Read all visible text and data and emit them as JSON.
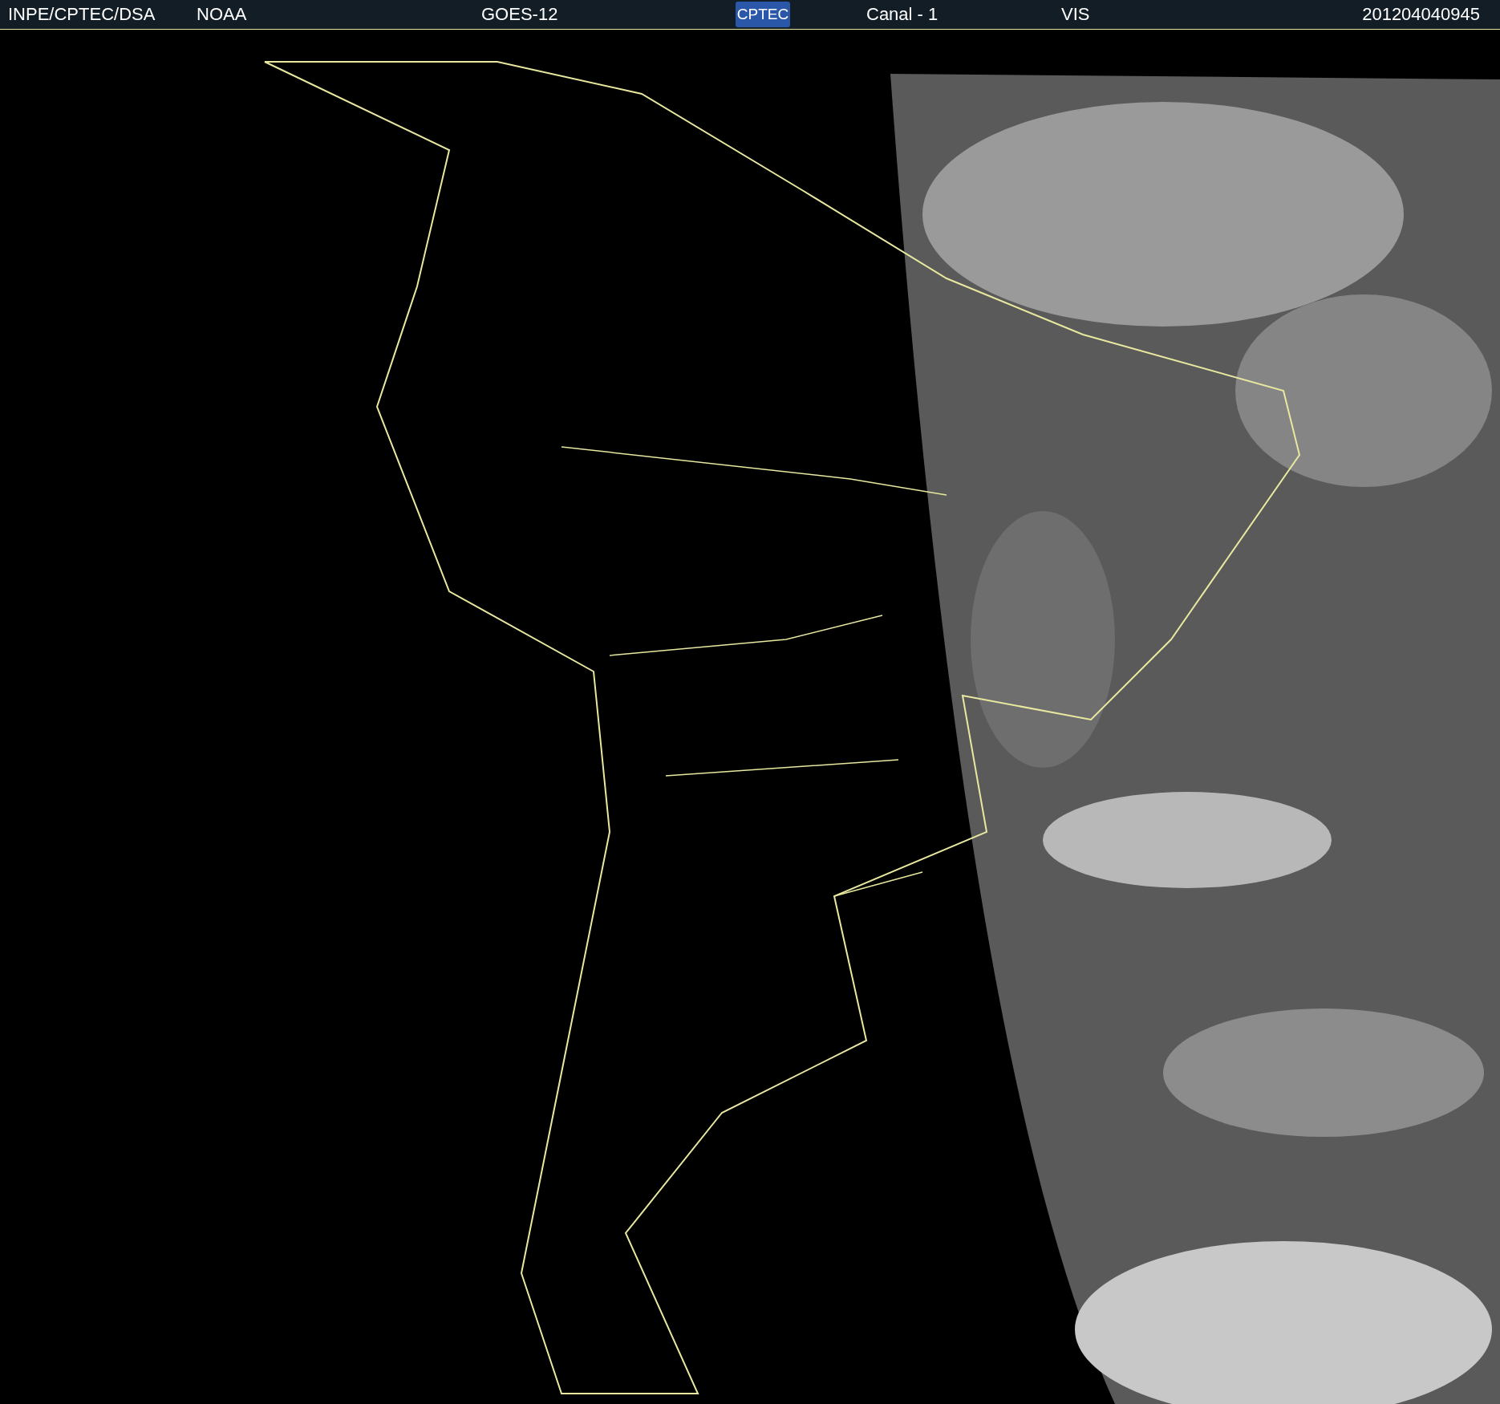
{
  "header": {
    "source": "INPE/CPTEC/DSA",
    "agency": "NOAA",
    "satellite": "GOES-12",
    "logo": "CPTEC",
    "channel": "Canal - 1",
    "band": "VIS",
    "timestamp": "201204040945"
  }
}
